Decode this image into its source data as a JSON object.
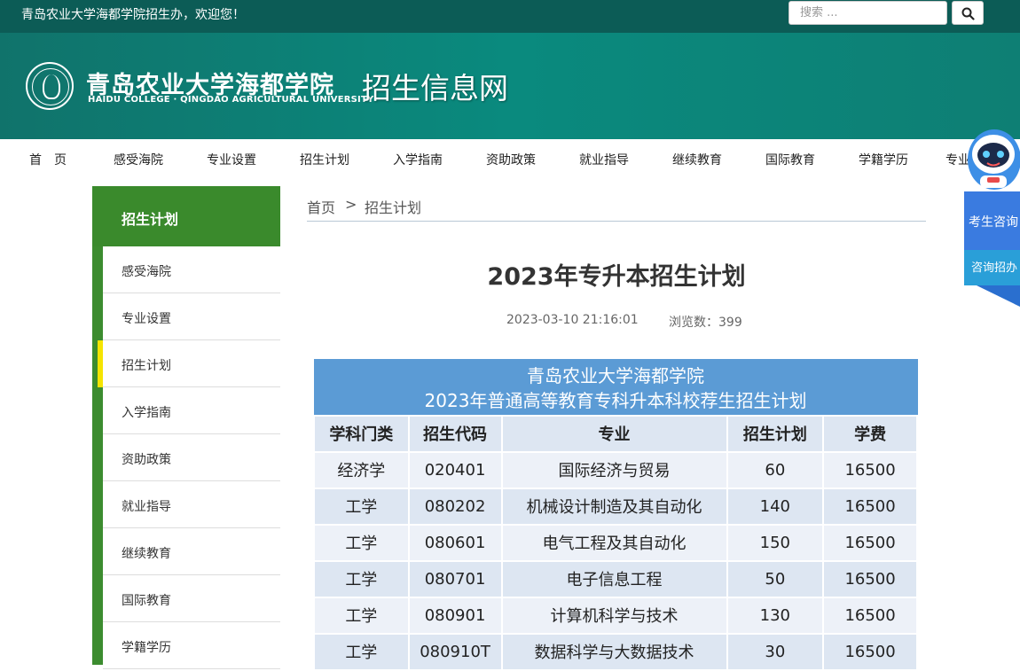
{
  "topbar": {
    "welcome": "青岛农业大学海都学院招生办，欢迎您！",
    "search_placeholder": "搜索 ..."
  },
  "header": {
    "college_cn": "青岛农业大学海都学院",
    "college_en": "HAIDU COLLEGE · QINGDAO AGRICULTURAL UNIVERSITY",
    "site_title": "招生信息网"
  },
  "nav": [
    "首　页",
    "感受海院",
    "专业设置",
    "招生计划",
    "入学指南",
    "资助政策",
    "就业指导",
    "继续教育",
    "国际教育",
    "学籍学历",
    "专业"
  ],
  "sidebar": {
    "title": "招生计划",
    "items": [
      "感受海院",
      "专业设置",
      "招生计划",
      "入学指南",
      "资助政策",
      "就业指导",
      "继续教育",
      "国际教育",
      "学籍学历"
    ],
    "active_index": 2
  },
  "breadcrumb": {
    "home": "首页",
    "separator": ">",
    "current": "招生计划"
  },
  "article": {
    "title": "2023年专升本招生计划",
    "date": "2023-03-10 21:16:01",
    "views_label": "浏览数：",
    "views": "399"
  },
  "table": {
    "banner_line1": "青岛农业大学海都学院",
    "banner_line2": "2023年普通高等教育专科升本科校荐生招生计划",
    "headers": [
      "学科门类",
      "招生代码",
      "专业",
      "招生计划",
      "学费"
    ],
    "rows": [
      [
        "经济学",
        "020401",
        "国际经济与贸易",
        "60",
        "16500"
      ],
      [
        "工学",
        "080202",
        "机械设计制造及其自动化",
        "140",
        "16500"
      ],
      [
        "工学",
        "080601",
        "电气工程及其自动化",
        "150",
        "16500"
      ],
      [
        "工学",
        "080701",
        "电子信息工程",
        "50",
        "16500"
      ],
      [
        "工学",
        "080901",
        "计算机科学与技术",
        "130",
        "16500"
      ],
      [
        "工学",
        "080910T",
        "数据科学与大数据技术",
        "30",
        "16500"
      ]
    ]
  },
  "float_widget": {
    "consult_label": "考生咨询",
    "office_label": "咨询招办"
  },
  "icons": {
    "search": "search-icon",
    "robot": "robot-avatar-icon",
    "emblem": "college-emblem-icon"
  },
  "colors": {
    "topbar": "#0c5c56",
    "header": "#0a8a7e",
    "sidebar_green": "#3a8a2c",
    "active_marker": "#f5e400",
    "table_banner": "#5b9bd5",
    "consult_blue": "#3a7be0"
  }
}
